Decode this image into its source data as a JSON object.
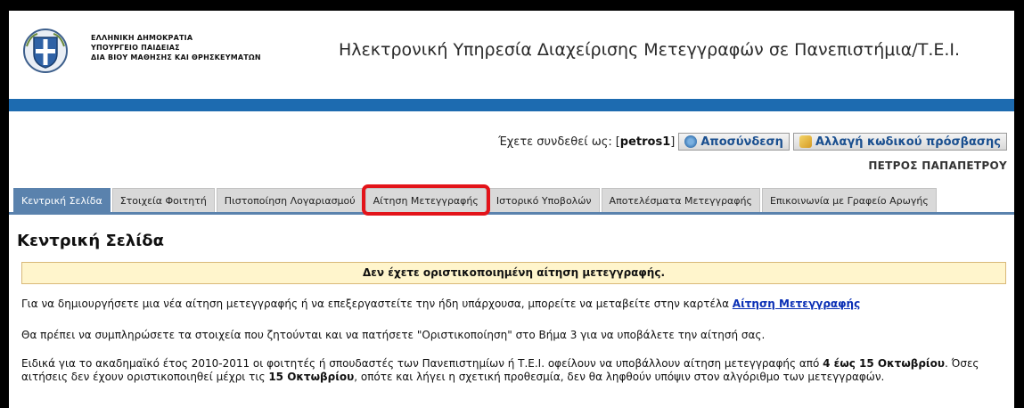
{
  "header": {
    "ministry_lines": [
      "ΕΛΛΗΝΙΚΗ ΔΗΜΟΚΡΑΤΙΑ",
      "ΥΠΟΥΡΓΕΙΟ ΠΑΙΔΕΙΑΣ",
      "ΔΙΑ ΒΙΟΥ ΜΑΘΗΣΗΣ ΚΑΙ ΘΡΗΣΚΕΥΜΑΤΩΝ"
    ],
    "site_title": "Ηλεκτρονική Υπηρεσία Διαχείρισης Μετεγγραφών σε Πανεπιστήμια/Τ.Ε.Ι."
  },
  "user": {
    "logged_in_as_label": "Έχετε συνδεθεί ως:",
    "username_prefix": "[",
    "username": "petros1",
    "username_suffix": "]",
    "logout_label": "Αποσύνδεση",
    "change_password_label": "Αλλαγή κωδικού πρόσβασης",
    "full_name": "ΠΕΤΡΟΣ ΠΑΠΑΠΕΤΡΟΥ"
  },
  "tabs": [
    {
      "label": "Κεντρική Σελίδα",
      "active": true
    },
    {
      "label": "Στοιχεία Φοιτητή",
      "active": false
    },
    {
      "label": "Πιστοποίηση Λογαριασμού",
      "active": false
    },
    {
      "label": "Αίτηση Μετεγγραφής",
      "active": false,
      "highlighted": true
    },
    {
      "label": "Ιστορικό Υποβολών",
      "active": false
    },
    {
      "label": "Αποτελέσματα Μετεγγραφής",
      "active": false
    },
    {
      "label": "Επικοινωνία με Γραφείο Αρωγής",
      "active": false
    }
  ],
  "main": {
    "title": "Κεντρική Σελίδα",
    "notice": "Δεν έχετε οριστικοποιημένη αίτηση μετεγγραφής.",
    "p1_text": "Για να δημιουργήσετε μια νέα αίτηση μετεγγραφής ή να επεξεργαστείτε την ήδη υπάρχουσα, μπορείτε να μεταβείτε στην καρτέλα ",
    "p1_link": "Αίτηση Μετεγγραφής",
    "p2_text": "Θα πρέπει να συμπληρώσετε τα στοιχεία που ζητούνται και να πατήσετε \"Οριστικοποίηση\" στο Βήμα 3 για να υποβάλετε την αίτησή σας.",
    "p3_a": "Ειδικά για το ακαδημαϊκό έτος 2010-2011 οι φοιτητές ή σπουδαστές των Πανεπιστημίων ή Τ.Ε.Ι. οφείλουν να υποβάλλουν αίτηση μετεγγραφής από ",
    "p3_b": "4 έως 15 Οκτωβρίου",
    "p3_c": ". Όσες αιτήσεις δεν έχουν οριστικοποιηθεί μέχρι τις ",
    "p3_d": "15 Οκτωβρίου",
    "p3_e": ", οπότε και λήγει η σχετική προθεσμία, δεν θα ληφθούν υπόψιν στον αλγόριθμο των μετεγγραφών."
  },
  "colors": {
    "brand_blue": "#1d6bb0",
    "active_tab": "#5a82ad",
    "highlight": "#e3141a",
    "notice_bg": "#fff5cc"
  },
  "icons": {
    "emblem": "greek-coat-of-arms-icon",
    "logout": "logout-icon",
    "change_password": "key-icon"
  }
}
